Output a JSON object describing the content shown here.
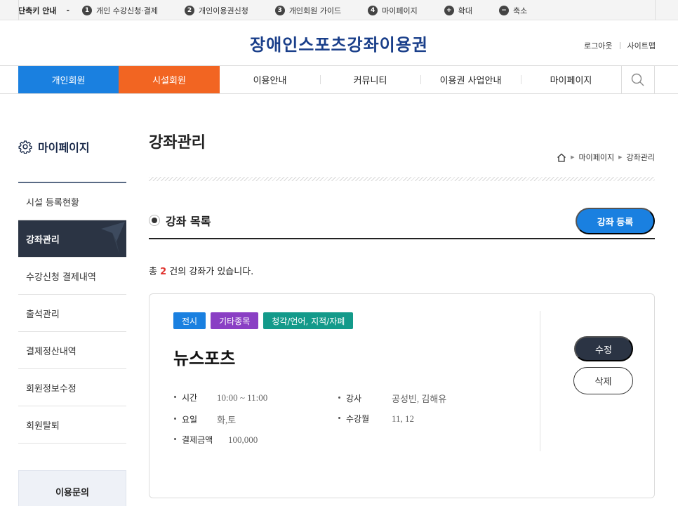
{
  "utility": {
    "title": "단축키 안내",
    "dash": "-",
    "items": [
      {
        "num": "1",
        "label": "개인 수강신청·결제"
      },
      {
        "num": "2",
        "label": "개인이용권신청"
      },
      {
        "num": "3",
        "label": "개인회원 가이드"
      },
      {
        "num": "4",
        "label": "마이페이지"
      },
      {
        "num": "+",
        "label": "확대"
      },
      {
        "num": "−",
        "label": "축소"
      }
    ]
  },
  "header": {
    "site_title": "장애인스포츠강좌이용권",
    "logout": "로그아웃",
    "sitemap": "사이트맵"
  },
  "gnb": {
    "items": [
      "개인회원",
      "시설회원",
      "이용안내",
      "커뮤니티",
      "이용권 사업안내",
      "마이페이지"
    ],
    "search_icon": "search-icon"
  },
  "sidebar": {
    "title": "마이페이지",
    "items": [
      "시설 등록현황",
      "강좌관리",
      "수강신청 결제내역",
      "출석관리",
      "결제정산내역",
      "회원정보수정",
      "회원탈퇴"
    ],
    "active_index": 1,
    "inquiry": "이용문의"
  },
  "main": {
    "page_title": "강좌관리",
    "breadcrumb": [
      "마이페이지",
      "강좌관리"
    ],
    "section_title": "강좌 목록",
    "register_button": "강좌 등록",
    "count_prefix": "총 ",
    "count": "2",
    "count_suffix": " 건의 강좌가 있습니다."
  },
  "course": {
    "tags": [
      "전시",
      "기타종목",
      "청각/언어, 지적/자폐"
    ],
    "title": "뉴스포츠",
    "time_label": "시간",
    "time_value": "10:00 ~ 11:00",
    "day_label": "요일",
    "day_value": "화,토",
    "fee_label": "결제금액",
    "fee_value": "100,000",
    "instructor_label": "강사",
    "instructor_value": "공성빈,  김해유",
    "month_label": "수강월",
    "month_value": "11, 12",
    "edit_button": "수정",
    "delete_button": "삭제"
  },
  "colors": {
    "primary_blue": "#1a80e0",
    "orange": "#f26522",
    "navy": "#2b3444",
    "title_blue": "#1a3f8a",
    "count_red": "#e0322d"
  }
}
